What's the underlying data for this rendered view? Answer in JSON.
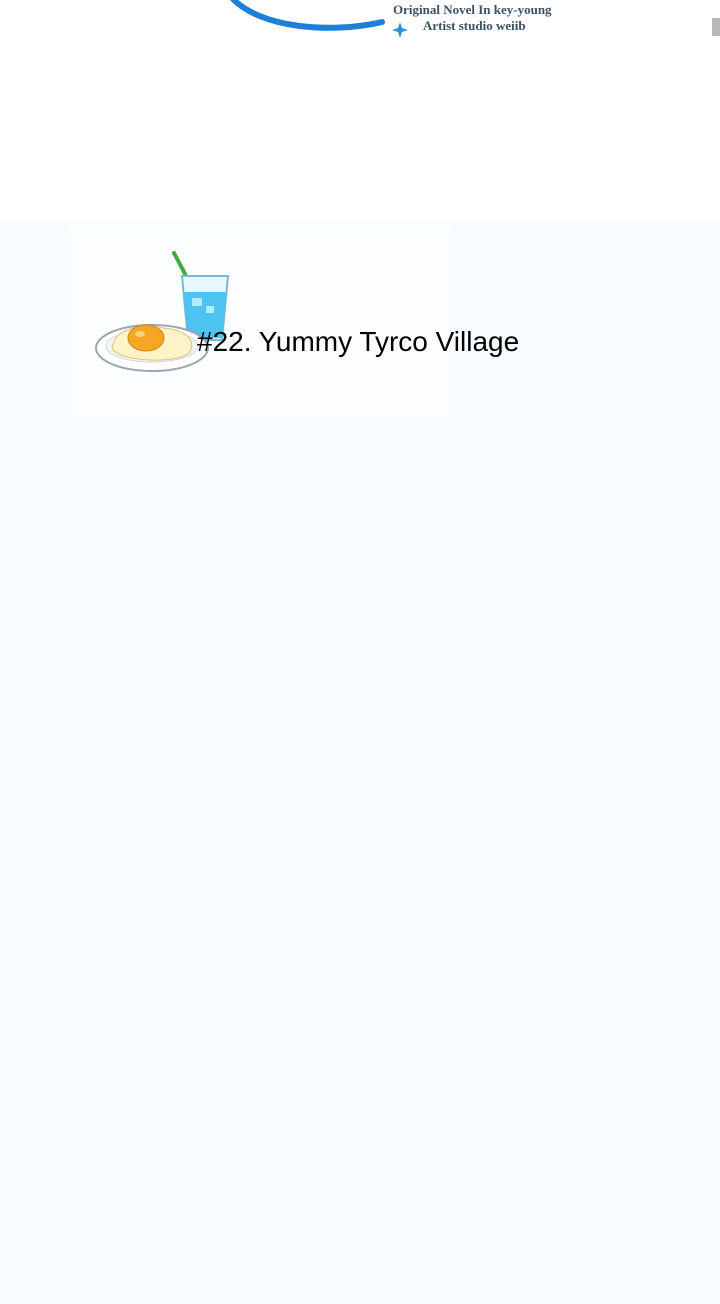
{
  "header": {
    "credit_line_1": "Original Novel  In key-young",
    "credit_line_2": "Artist  studio weiib"
  },
  "episode": {
    "title": "#22. Yummy Tyrco Village"
  },
  "colors": {
    "swoosh": "#1f7fd6",
    "credits_text": "#3b5266",
    "sparkle": "#2f8fd8",
    "page_background": "#f9fdff",
    "drink": "#4cc3f0",
    "straw": "#3fae3f",
    "egg_yolk": "#f5a623"
  },
  "icons": {
    "food": "fried-egg-and-soda-icon",
    "sparkle": "sparkle-icon"
  }
}
